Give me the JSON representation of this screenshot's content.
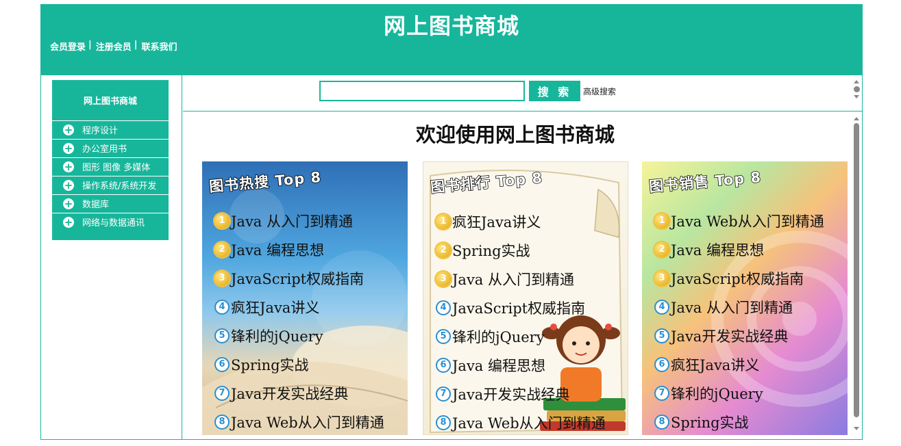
{
  "header": {
    "title": "网上图书商城",
    "links": [
      "会员登录",
      "注册会员",
      "联系我们"
    ],
    "separator": "|"
  },
  "sidebar": {
    "title": "网上图书商城",
    "items": [
      {
        "label": "程序设计"
      },
      {
        "label": "办公室用书"
      },
      {
        "label": "图形 图像 多媒体"
      },
      {
        "label": "操作系统/系统开发"
      },
      {
        "label": "数据库"
      },
      {
        "label": "网络与数据通讯"
      }
    ]
  },
  "search": {
    "value": "",
    "button_label": "搜 索",
    "advanced_label": "高级搜索"
  },
  "main": {
    "welcome": "欢迎使用网上图书商城",
    "cards": [
      {
        "title": "图书热搜 Top 8",
        "books": [
          "Java 从入门到精通",
          "Java 编程思想",
          "JavaScript权威指南",
          "疯狂Java讲义",
          "锋利的jQuery",
          "Spring实战",
          "Java开发实战经典",
          "Java Web从入门到精通"
        ]
      },
      {
        "title": "图书排行 Top 8",
        "books": [
          "疯狂Java讲义",
          "Spring实战",
          "Java 从入门到精通",
          "JavaScript权威指南",
          "锋利的jQuery",
          "Java 编程思想",
          "Java开发实战经典",
          "Java Web从入门到精通"
        ]
      },
      {
        "title": "图书销售 Top 8",
        "books": [
          "Java Web从入门到精通",
          "Java 编程思想",
          "JavaScript权威指南",
          "Java 从入门到精通",
          "Java开发实战经典",
          "疯狂Java讲义",
          "锋利的jQuery",
          "Spring实战"
        ]
      }
    ],
    "ranks": [
      "1",
      "2",
      "3",
      "4",
      "5",
      "6",
      "7",
      "8"
    ]
  },
  "colors": {
    "accent": "#17b69b",
    "rank_gold": "#e3a40d",
    "rank_blue": "#2a8fd0"
  },
  "icons": {
    "sidebar_item": "plus-circle-icon"
  }
}
